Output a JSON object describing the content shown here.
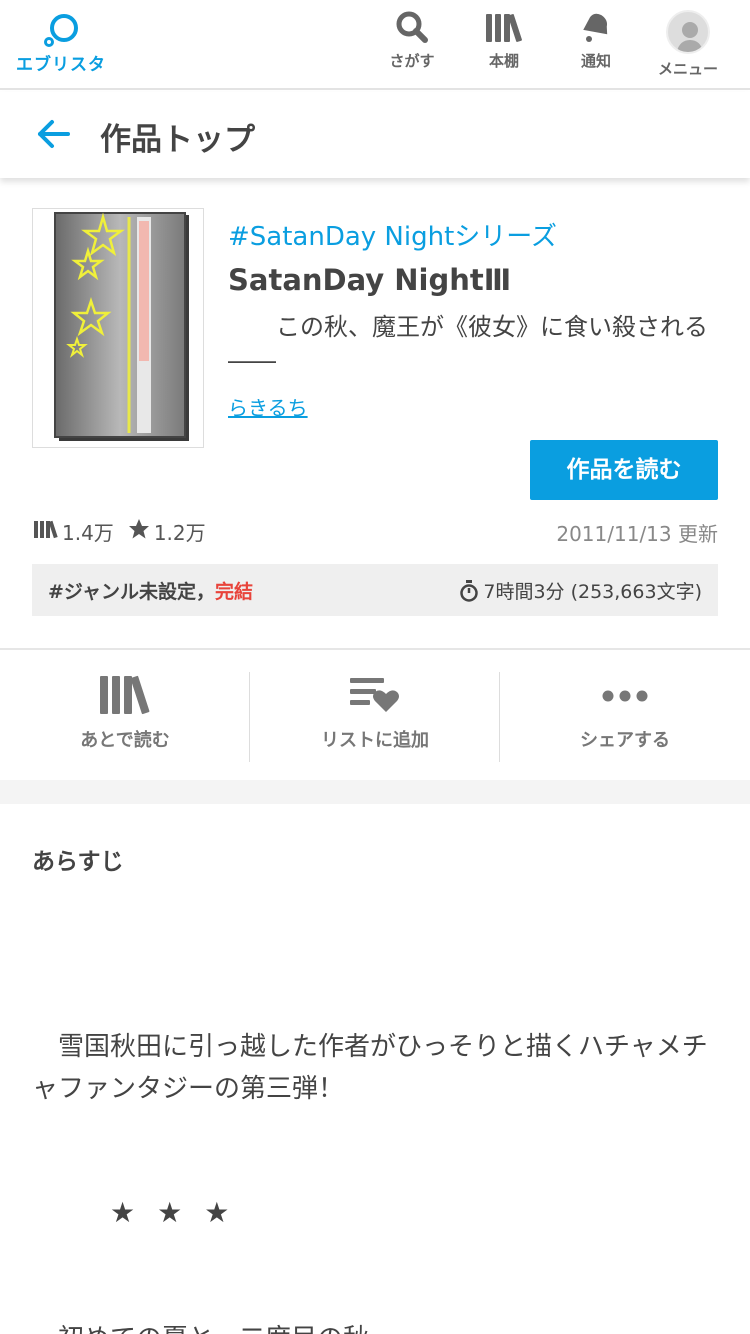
{
  "header": {
    "logo_text": "エブリスタ",
    "nav": {
      "search": "さがす",
      "shelf": "本棚",
      "notify": "通知",
      "menu": "メニュー"
    }
  },
  "titlebar": {
    "title": "作品トップ"
  },
  "work": {
    "series": "#SatanDay Nightシリーズ",
    "title": "SatanDay NightⅢ",
    "catch": "　　この秋、魔王が《彼女》に食い殺される――",
    "author": "らきるち",
    "read_button": "作品を読む",
    "shelf_count": "1.4万",
    "star_count": "1.2万",
    "updated": "2011/11/13 更新",
    "genre": "#ジャンル未設定",
    "genre_sep": "，",
    "status": "完結",
    "read_time": "7時間3分 (253,663文字)"
  },
  "actions": {
    "later": "あとで読む",
    "add_list": "リストに追加",
    "share": "シェアする"
  },
  "synopsis": {
    "heading": "あらすじ",
    "body": "　雪国秋田に引っ越した作者がひっそりと描くハチャメチャファンタジーの第三弾！",
    "stars": "★★★",
    "tail": "　初めての夏と、二度目の秋"
  },
  "colors": {
    "accent": "#0a9ee0",
    "complete": "#e8433a"
  }
}
